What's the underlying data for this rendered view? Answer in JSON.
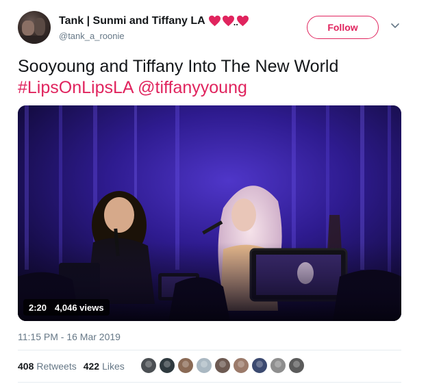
{
  "user": {
    "display_name": "Tank | Sunmi and Tiffany LA",
    "handle": "@tank_a_roonie",
    "name_suffix": "..",
    "avatar_icon": "user-avatar"
  },
  "follow_label": "Follow",
  "tweet": {
    "text_line1": "Sooyoung and Tiffany Into The New World",
    "hashtag": "#LipsOnLipsLA",
    "mention": "@tiffanyyoung",
    "timestamp": "11:15 PM - 16 Mar 2019"
  },
  "video": {
    "duration": "2:20",
    "views": "4,046 views"
  },
  "stats": {
    "retweets_count": "408",
    "retweets_label": "Retweets",
    "likes_count": "422",
    "likes_label": "Likes"
  },
  "likers": [
    "#4b4f53",
    "#2f3a3f",
    "#8a6a55",
    "#aab8c2",
    "#6d5a52",
    "#9b7a6a",
    "#3c4a70",
    "#8e8e8e",
    "#5b5b5b"
  ],
  "colors": {
    "accent": "#e0245e",
    "secondary_text": "#657786",
    "heart": "#e0245e"
  }
}
